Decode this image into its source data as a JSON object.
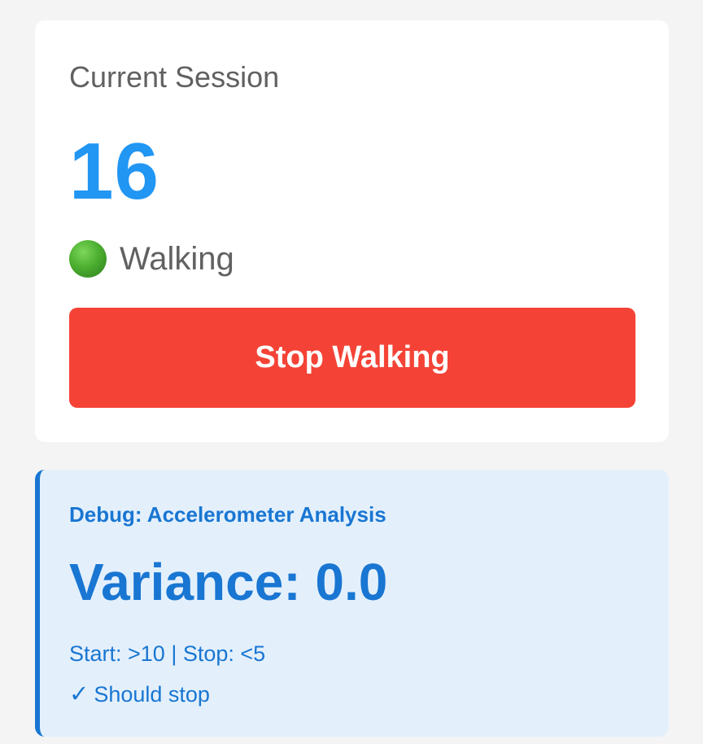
{
  "session": {
    "title": "Current Session",
    "step_count": "16",
    "status_label": "Walking",
    "status_icon": "green-circle-icon",
    "status_color": "#4caf30",
    "stop_button_label": "Stop Walking",
    "stop_button_color": "#f44336",
    "count_color": "#2196f3"
  },
  "debug": {
    "title": "Debug: Accelerometer Analysis",
    "variance_text": "Variance: 0.0",
    "thresholds_text": "Start: >10 | Stop: <5",
    "verdict_icon": "checkmark-icon",
    "verdict_icon_glyph": "✓",
    "verdict_text": "Should stop",
    "accent_color": "#1976d2",
    "background_color": "#e3f0fc"
  }
}
